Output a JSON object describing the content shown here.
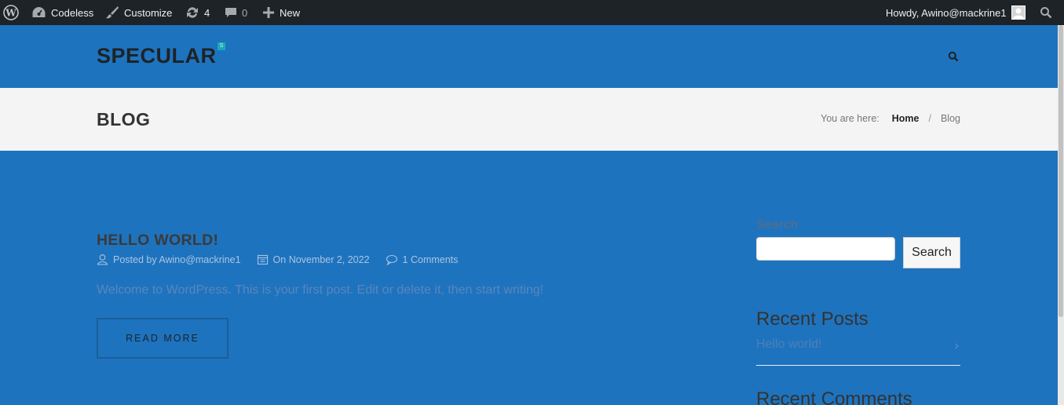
{
  "adminbar": {
    "site_name": "Codeless",
    "customize": "Customize",
    "updates_count": "4",
    "comments_count": "0",
    "new_label": "New",
    "greeting": "Howdy, Awino@mackrine1"
  },
  "header": {
    "logo": "SPECULAR",
    "logo_badge": "S"
  },
  "titlebar": {
    "page_title": "BLOG",
    "breadcrumb_prefix": "You are here:",
    "breadcrumb_home": "Home",
    "breadcrumb_sep": "/",
    "breadcrumb_current": "Blog"
  },
  "post": {
    "title": "HELLO WORLD!",
    "author": "Posted by Awino@mackrine1",
    "date": "On November 2, 2022",
    "comments": "1 Comments",
    "excerpt": "Welcome to WordPress. This is your first post. Edit or delete it, then start writing!",
    "read_more": "READ MORE"
  },
  "sidebar": {
    "search_title": "Search",
    "search_button": "Search",
    "recent_posts_title": "Recent Posts",
    "recent_posts": [
      "Hello world!"
    ],
    "recent_comments_title": "Recent Comments"
  },
  "colors": {
    "brand_blue": "#1e73be",
    "admin_bar": "#1d2327",
    "title_bar": "#f4f4f4"
  }
}
